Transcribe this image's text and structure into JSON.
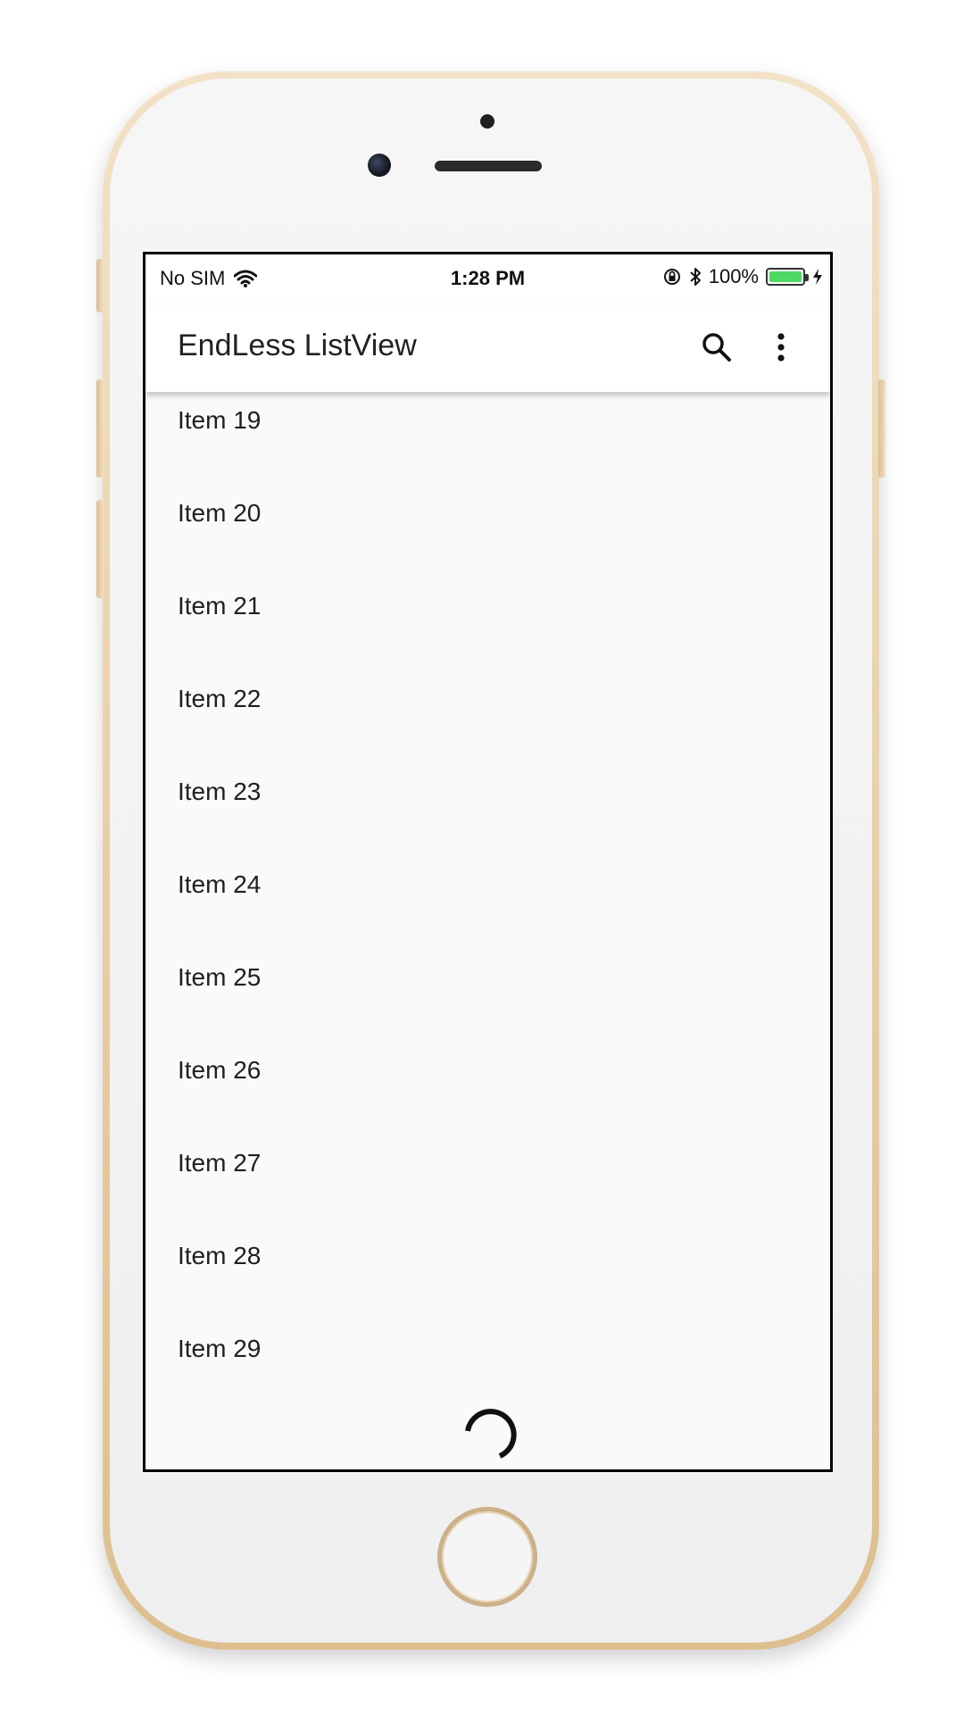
{
  "status_bar": {
    "carrier": "No SIM",
    "time": "1:28 PM",
    "battery_percent": "100%"
  },
  "app_bar": {
    "title": "EndLess ListView",
    "actions": [
      "search-icon",
      "more-vert-icon"
    ]
  },
  "list": {
    "items": [
      {
        "label": "Item 19"
      },
      {
        "label": "Item 20"
      },
      {
        "label": "Item 21"
      },
      {
        "label": "Item 22"
      },
      {
        "label": "Item 23"
      },
      {
        "label": "Item 24"
      },
      {
        "label": "Item 25"
      },
      {
        "label": "Item 26"
      },
      {
        "label": "Item 27"
      },
      {
        "label": "Item 28"
      },
      {
        "label": "Item 29"
      }
    ]
  },
  "loading": {
    "indicator": "progress-spinner-icon"
  },
  "colors": {
    "battery": "#4cd964",
    "device_gold": "#e8cfa6"
  }
}
